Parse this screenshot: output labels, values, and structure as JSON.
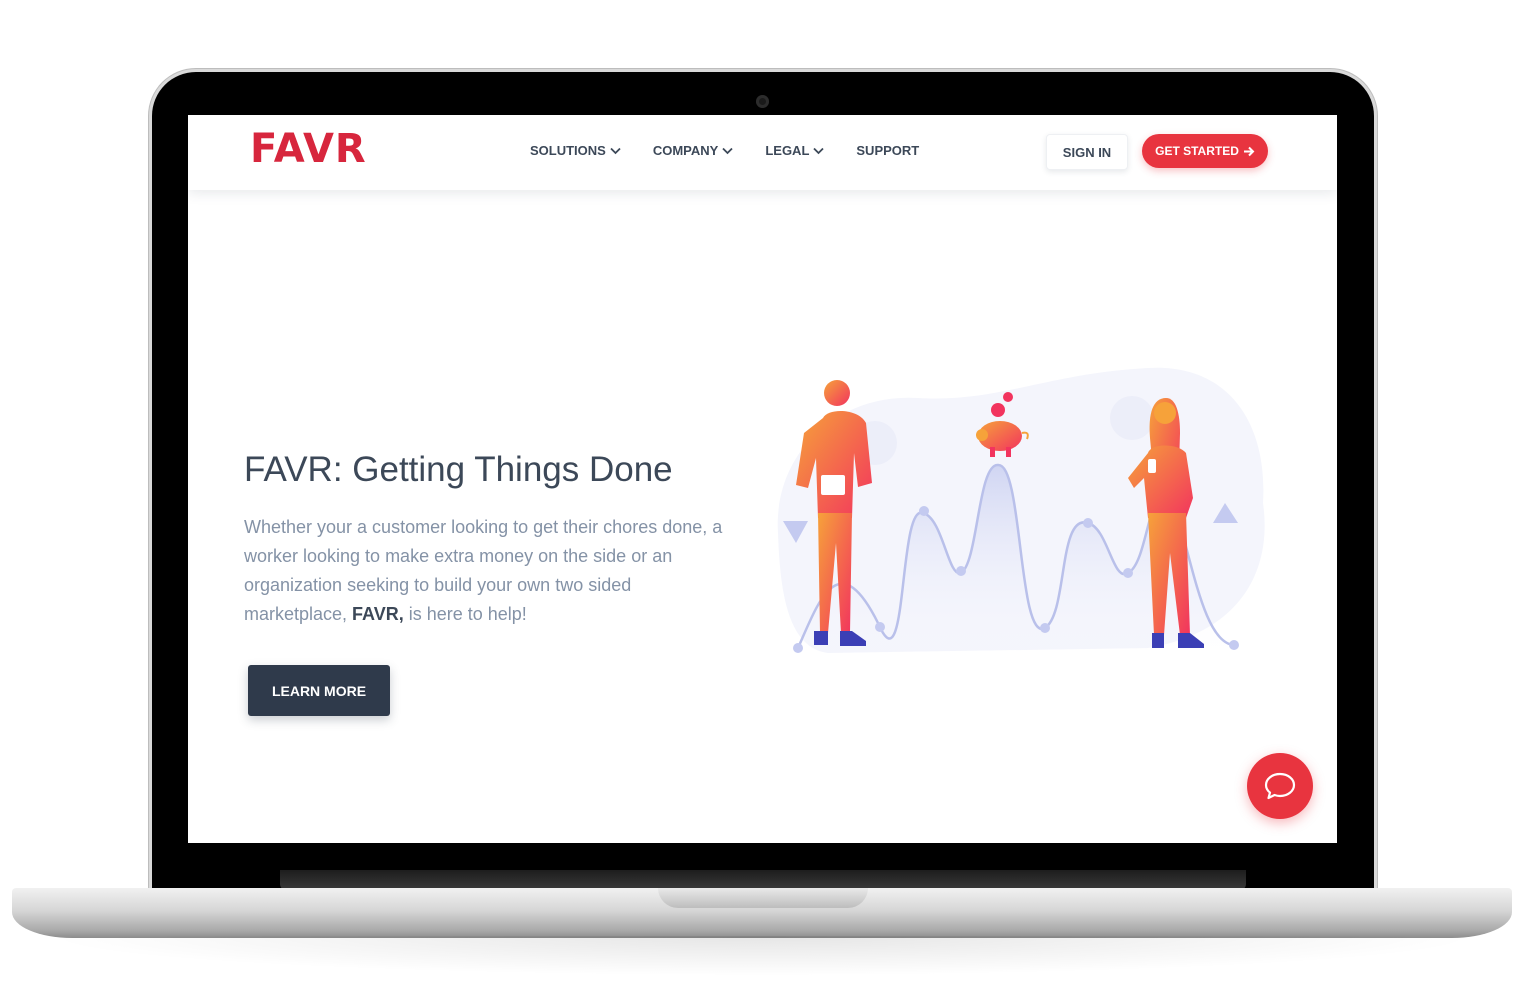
{
  "brand": {
    "logo_text": "FAVR",
    "color": "#d7263d"
  },
  "nav": {
    "items": [
      {
        "label": "SOLUTIONS",
        "has_dropdown": true
      },
      {
        "label": "COMPANY",
        "has_dropdown": true
      },
      {
        "label": "LEGAL",
        "has_dropdown": true
      },
      {
        "label": "SUPPORT",
        "has_dropdown": false
      }
    ],
    "sign_in_label": "SIGN IN",
    "get_started_label": "GET STARTED",
    "get_started_icon": "arrow-right-icon",
    "accent_color": "#e8343f"
  },
  "hero": {
    "title": "FAVR: Getting Things Done",
    "text_before": "Whether your a customer looking to get their chores done, a worker looking to make extra money on the side or an organization seeking to build your own two sided marketplace, ",
    "text_bold": "FAVR,",
    "text_after": " is here to help!",
    "learn_more_label": "LEARN MORE"
  },
  "chat": {
    "icon": "chat-bubble-icon"
  }
}
